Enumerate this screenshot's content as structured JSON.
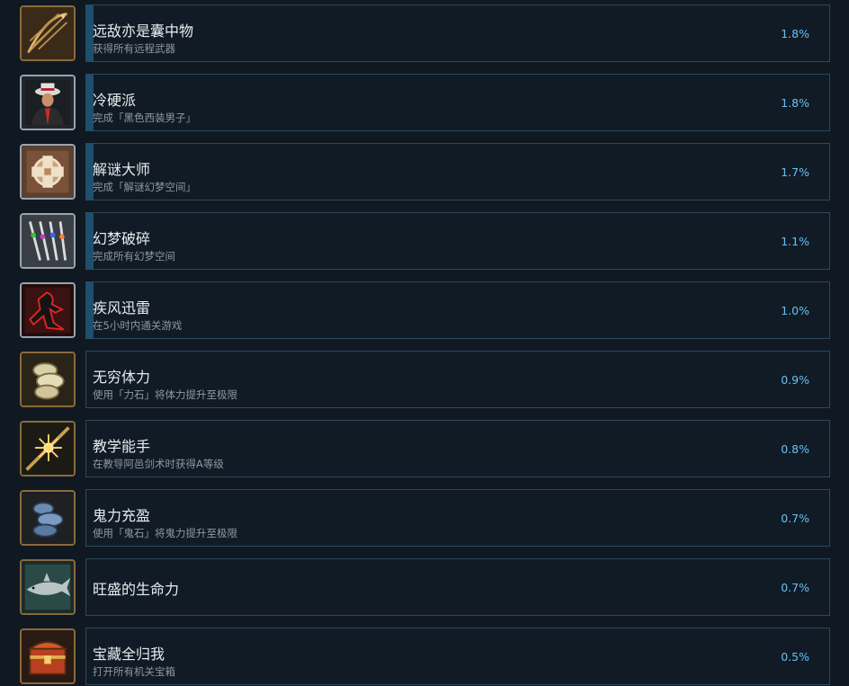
{
  "achievements": [
    {
      "title": "远敌亦是囊中物",
      "desc": "获得所有远程武器",
      "percent": "1.8%",
      "progress": 0.01,
      "icon": "bow-arrows-icon",
      "frame": "#8a6a3a"
    },
    {
      "title": "冷硬派",
      "desc": "完成「黑色西装男子」",
      "percent": "1.8%",
      "progress": 0.01,
      "icon": "man-in-suit-icon",
      "frame": "#9aa4ad"
    },
    {
      "title": "解谜大师",
      "desc": "完成「解谜幻梦空间」",
      "percent": "1.7%",
      "progress": 0.01,
      "icon": "puzzle-box-icon",
      "frame": "#9aa4ad"
    },
    {
      "title": "幻梦破碎",
      "desc": "完成所有幻梦空间",
      "percent": "1.1%",
      "progress": 0.01,
      "icon": "crystal-swords-icon",
      "frame": "#9aa4ad"
    },
    {
      "title": "疾风迅雷",
      "desc": "在5小时内通关游戏",
      "percent": "1.0%",
      "progress": 0.01,
      "icon": "red-runner-icon",
      "frame": "#9aa4ad"
    },
    {
      "title": "无穷体力",
      "desc": "使用「力石」将体力提升至极限",
      "percent": "0.9%",
      "progress": 0.0,
      "icon": "power-stone-icon",
      "frame": "#8a6a3a"
    },
    {
      "title": "教学能手",
      "desc": "在教导阿邑剑术时获得A等级",
      "percent": "0.8%",
      "progress": 0.0,
      "icon": "sword-spark-icon",
      "frame": "#8a6a3a"
    },
    {
      "title": "鬼力充盈",
      "desc": "使用「鬼石」将鬼力提升至极限",
      "percent": "0.7%",
      "progress": 0.0,
      "icon": "oni-stone-icon",
      "frame": "#8a6a3a"
    },
    {
      "title": "旺盛的生命力",
      "desc": "",
      "percent": "0.7%",
      "progress": 0.0,
      "icon": "shark-icon",
      "frame": "#8a6a3a"
    },
    {
      "title": "宝藏全归我",
      "desc": "打开所有机关宝箱",
      "percent": "0.5%",
      "progress": 0.0,
      "icon": "treasure-chest-icon",
      "frame": "#8a6a3a"
    }
  ]
}
